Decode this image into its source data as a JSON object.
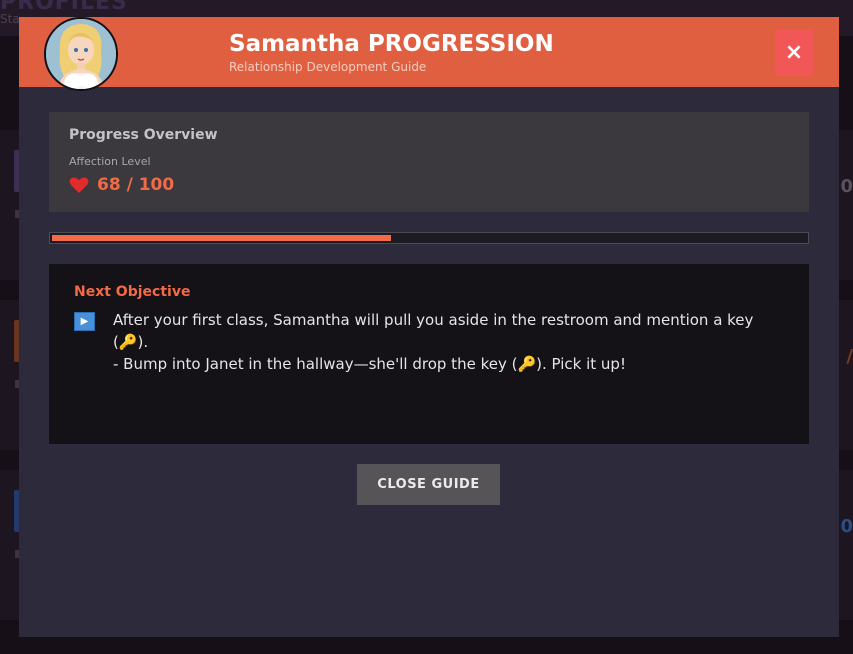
{
  "background": {
    "logo_text": "PROFILES",
    "subtitle_text": "Sta"
  },
  "modal": {
    "title": "Samantha PROGRESSION",
    "subtitle": "Relationship Development Guide",
    "close_icon": "×",
    "avatar_icon": "character-portrait",
    "accent_color": "#e05f41"
  },
  "overview": {
    "title": "Progress Overview",
    "affection_label": "Affection Level",
    "heart_icon": "❤",
    "affection_value": "68 / 100",
    "progress_fraction": 0.45
  },
  "objective": {
    "title": "Next Objective",
    "play_icon": "▶",
    "lines": [
      "After your first class, Samantha will pull you aside in the restroom and mention a key (🔑).",
      "- Bump into Janet in the hallway—she'll drop the key (🔑). Pick it up!"
    ]
  },
  "actions": {
    "close_guide_label": "CLOSE GUIDE"
  }
}
